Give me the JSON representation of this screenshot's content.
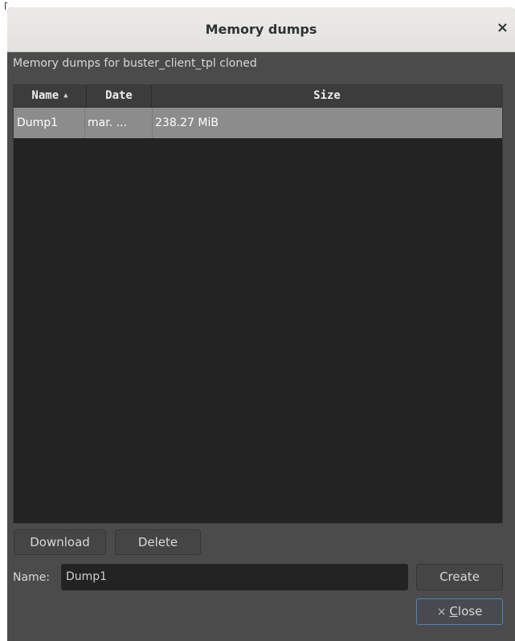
{
  "window": {
    "title": "Memory dumps",
    "close_glyph": "×"
  },
  "subtitle": "Memory dumps for buster_client_tpl cloned",
  "table": {
    "columns": [
      {
        "label": "Name",
        "sort": "ascending"
      },
      {
        "label": "Date"
      },
      {
        "label": "Size"
      }
    ],
    "rows": [
      {
        "name": "Dump1",
        "date": "mar. ...",
        "size": "238.27 MiB",
        "selected": true
      }
    ]
  },
  "buttons": {
    "download": "Download",
    "delete": "Delete",
    "create": "Create",
    "close_icon": "×",
    "close_mnemonic": "C",
    "close_rest": "lose"
  },
  "name_field": {
    "label": "Name:",
    "value": "Dump1"
  },
  "icons": {
    "sort_ascending": "▲"
  },
  "colors": {
    "titlebar": "#e8e7e5",
    "dialog_bg": "#4b4b4b",
    "table_bg": "#232323",
    "selected_row": "#8c8c8c",
    "focus_border": "#4f84c4"
  }
}
